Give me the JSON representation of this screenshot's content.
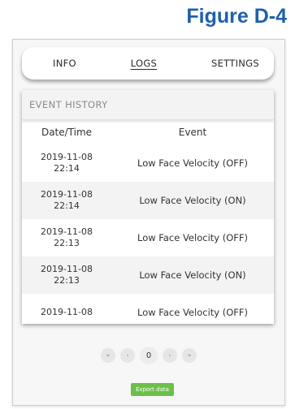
{
  "figure_label": "Figure D-4",
  "nav": {
    "items": [
      {
        "label": "INFO",
        "active": false
      },
      {
        "label": "LOGS",
        "active": true
      },
      {
        "label": "SETTINGS",
        "active": false
      }
    ]
  },
  "panel": {
    "title": "EVENT HISTORY",
    "columns": [
      "Date/Time",
      "Event"
    ],
    "rows": [
      {
        "date": "2019-11-08",
        "time": "22:14",
        "event": "Low Face Velocity (OFF)"
      },
      {
        "date": "2019-11-08",
        "time": "22:14",
        "event": "Low Face Velocity (ON)"
      },
      {
        "date": "2019-11-08",
        "time": "22:13",
        "event": "Low Face Velocity (OFF)"
      },
      {
        "date": "2019-11-08",
        "time": "22:13",
        "event": "Low Face Velocity (ON)"
      },
      {
        "date": "2019-11-08",
        "time": "",
        "event": "Low Face Velocity (OFF)"
      }
    ]
  },
  "pagination": {
    "first": "«",
    "prev": "‹",
    "current": "0",
    "next": "›",
    "last": "»"
  },
  "export_label": "Export data",
  "colors": {
    "figure_label": "#1f5fae",
    "export_button": "#6cc04a"
  }
}
